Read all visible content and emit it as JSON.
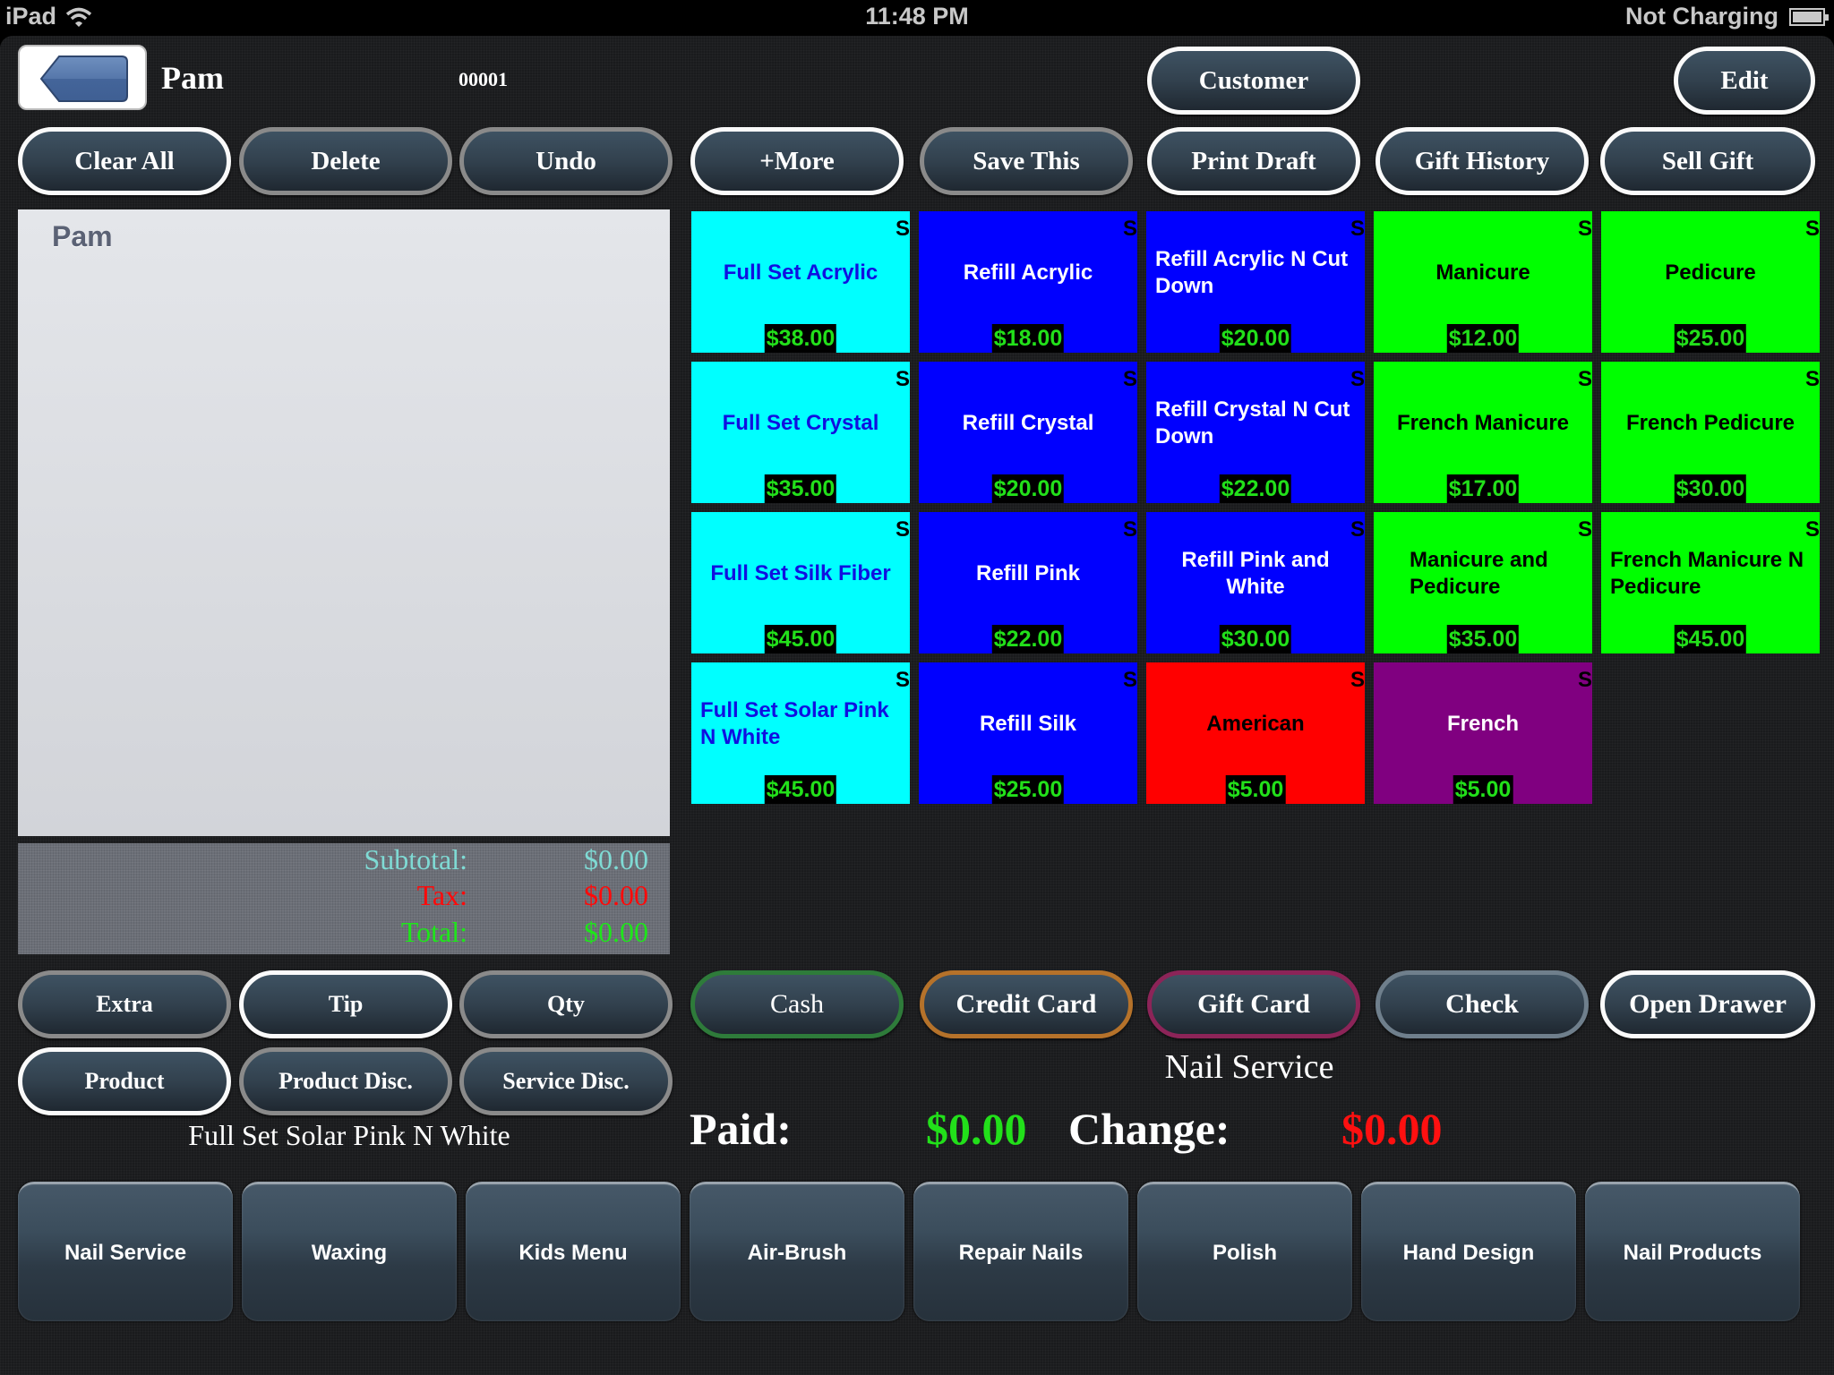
{
  "status_bar": {
    "device": "iPad",
    "time": "11:48 PM",
    "battery_text": "Not Charging",
    "battery_level": 1.0
  },
  "header": {
    "customer_name": "Pam",
    "ticket_number": "00001",
    "customer_button": "Customer",
    "edit_button": "Edit"
  },
  "toolbar": [
    {
      "label": "Clear All",
      "active": true
    },
    {
      "label": "Delete",
      "active": false
    },
    {
      "label": "Undo",
      "active": false
    },
    {
      "label": "+More",
      "active": true
    },
    {
      "label": "Save This",
      "active": false
    },
    {
      "label": "Print Draft",
      "active": true
    },
    {
      "label": "Gift History",
      "active": true
    },
    {
      "label": "Sell Gift",
      "active": true
    }
  ],
  "receipt": {
    "customer_name": "Pam",
    "subtotal_label": "Subtotal:",
    "subtotal": "$0.00",
    "tax_label": "Tax:",
    "tax": "$0.00",
    "total_label": "Total:",
    "total": "$0.00",
    "colors": {
      "subtotal": "#7fdad4",
      "tax": "#ff0a0a",
      "total": "#1ee61a"
    }
  },
  "services": [
    {
      "name": "Full Set Acrylic",
      "price": "$38.00",
      "badge": "S",
      "bg": "#00ffff",
      "fg": "#1010e0"
    },
    {
      "name": "Refill Acrylic",
      "price": "$18.00",
      "badge": "S",
      "bg": "#0000ff",
      "fg": "#ffffff"
    },
    {
      "name": "Refill Acrylic N Cut Down",
      "price": "$20.00",
      "badge": "S",
      "bg": "#0000ff",
      "fg": "#ffffff",
      "align": "left"
    },
    {
      "name": "Manicure",
      "price": "$12.00",
      "badge": "S",
      "bg": "#00ff00",
      "fg": "#000000"
    },
    {
      "name": "Pedicure",
      "price": "$25.00",
      "badge": "S",
      "bg": "#00ff00",
      "fg": "#000000"
    },
    {
      "name": "Full Set Crystal",
      "price": "$35.00",
      "badge": "S",
      "bg": "#00ffff",
      "fg": "#1010e0"
    },
    {
      "name": "Refill Crystal",
      "price": "$20.00",
      "badge": "S",
      "bg": "#0000ff",
      "fg": "#ffffff"
    },
    {
      "name": "Refill Crystal N Cut Down",
      "price": "$22.00",
      "badge": "S",
      "bg": "#0000ff",
      "fg": "#ffffff",
      "align": "left"
    },
    {
      "name": "French Manicure",
      "price": "$17.00",
      "badge": "S",
      "bg": "#00ff00",
      "fg": "#000000"
    },
    {
      "name": "French Pedicure",
      "price": "$30.00",
      "badge": "S",
      "bg": "#00ff00",
      "fg": "#000000"
    },
    {
      "name": "Full Set Silk Fiber",
      "price": "$45.00",
      "badge": "S",
      "bg": "#00ffff",
      "fg": "#1010e0"
    },
    {
      "name": "Refill Pink",
      "price": "$22.00",
      "badge": "S",
      "bg": "#0000ff",
      "fg": "#ffffff"
    },
    {
      "name": "Refill Pink and White",
      "price": "$30.00",
      "badge": "S",
      "bg": "#0000ff",
      "fg": "#ffffff"
    },
    {
      "name": "Manicure and Pedicure",
      "price": "$35.00",
      "badge": "S",
      "bg": "#00ff00",
      "fg": "#000000",
      "align": "left",
      "indent": true
    },
    {
      "name": "French Manicure N Pedicure",
      "price": "$45.00",
      "badge": "S",
      "bg": "#00ff00",
      "fg": "#000000",
      "align": "left"
    },
    {
      "name": "Full Set Solar Pink N White",
      "price": "$45.00",
      "badge": "S",
      "bg": "#00ffff",
      "fg": "#1010e0",
      "align": "left"
    },
    {
      "name": "Refill Silk",
      "price": "$25.00",
      "badge": "S",
      "bg": "#0000ff",
      "fg": "#ffffff"
    },
    {
      "name": "American",
      "price": "$5.00",
      "badge": "S",
      "bg": "#ff0000",
      "fg": "#000000"
    },
    {
      "name": "French",
      "price": "$5.00",
      "badge": "S",
      "bg": "#800080",
      "fg": "#ffffff"
    }
  ],
  "modifiers": [
    {
      "label": "Extra",
      "active": false
    },
    {
      "label": "Tip",
      "active": true
    },
    {
      "label": "Qty",
      "active": false
    },
    {
      "label": "Product",
      "active": true
    },
    {
      "label": "Product Disc.",
      "active": false
    },
    {
      "label": "Service Disc.",
      "active": false
    }
  ],
  "selected_item": "Full Set Solar Pink N White",
  "payments": [
    {
      "label": "Cash",
      "border": "#2e7b3a",
      "bold": false
    },
    {
      "label": "Credit Card",
      "border": "#b5722a",
      "bold": true
    },
    {
      "label": "Gift Card",
      "border": "#8c2458",
      "bold": true
    },
    {
      "label": "Check",
      "border": "#6f7f8c",
      "bold": true
    },
    {
      "label": "Open Drawer",
      "border": "#fafafa",
      "bold": true
    }
  ],
  "current_category": "Nail Service",
  "payment_summary": {
    "paid_label": "Paid:",
    "paid": "$0.00",
    "change_label": "Change:",
    "change": "$0.00"
  },
  "categories": [
    "Nail Service",
    "Waxing",
    "Kids Menu",
    "Air-Brush",
    "Repair Nails",
    "Polish",
    "Hand Design",
    "Nail Products"
  ]
}
